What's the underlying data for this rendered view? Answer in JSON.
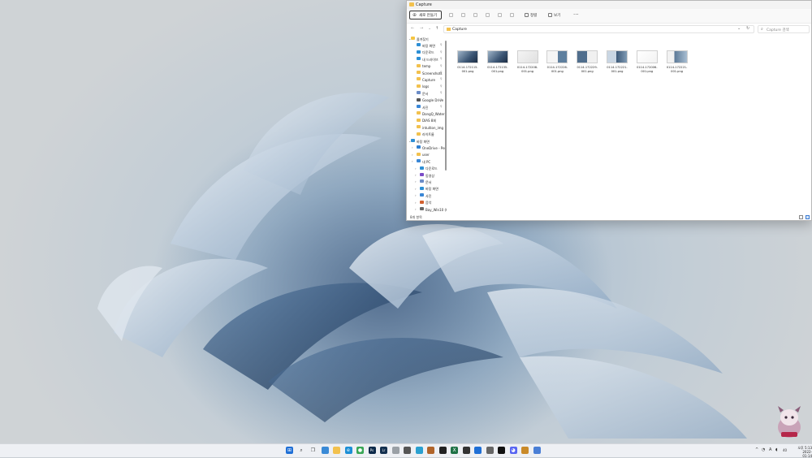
{
  "window": {
    "title": "Capture",
    "toolbar": {
      "new_label": "새로 만들기",
      "sort_label": "정렬",
      "view_label": "보기",
      "more_label": "···"
    },
    "address": {
      "path": "Capture",
      "breadcrumb_sep": "›"
    },
    "search": {
      "placeholder": "Capture 검색"
    },
    "nav": [
      {
        "label": "즐겨찾기",
        "color": "#f5c543",
        "pinned": false,
        "level": 0
      },
      {
        "label": "바탕 화면",
        "color": "#2d8fd5",
        "pinned": true,
        "level": 1
      },
      {
        "label": "다운로드",
        "color": "#2d8fd5",
        "pinned": true,
        "level": 1
      },
      {
        "label": "내 드라이브",
        "color": "#2d8fd5",
        "pinned": true,
        "level": 1
      },
      {
        "label": "temp",
        "color": "#f2c14e",
        "pinned": true,
        "level": 1
      },
      {
        "label": "Screenshots",
        "color": "#f2c14e",
        "pinned": true,
        "level": 1
      },
      {
        "label": "Capture",
        "color": "#f2c14e",
        "pinned": true,
        "level": 1
      },
      {
        "label": "logs",
        "color": "#f2c14e",
        "pinned": true,
        "level": 1
      },
      {
        "label": "문서",
        "color": "#6b8cc7",
        "pinned": true,
        "level": 1
      },
      {
        "label": "Google Drive",
        "color": "#555555",
        "pinned": true,
        "level": 1
      },
      {
        "label": "사진",
        "color": "#3a87d6",
        "pinned": true,
        "level": 1
      },
      {
        "label": "DongQ_Water",
        "color": "#f2c14e",
        "pinned": false,
        "level": 1
      },
      {
        "label": "DIAS 8회",
        "color": "#f2c14e",
        "pinned": false,
        "level": 1
      },
      {
        "label": "intuition_img",
        "color": "#f2c14e",
        "pinned": false,
        "level": 1
      },
      {
        "label": "라이트룸",
        "color": "#f2c14e",
        "pinned": false,
        "level": 1
      },
      {
        "label": "바탕 화면",
        "color": "#2d8fd5",
        "pinned": false,
        "level": 0
      },
      {
        "label": "OneDrive - Pers",
        "color": "#2f7fd1",
        "pinned": false,
        "level": 1
      },
      {
        "label": "user",
        "color": "#f2c14e",
        "pinned": false,
        "level": 1
      },
      {
        "label": "내 PC",
        "color": "#3a87d6",
        "pinned": false,
        "level": 1
      },
      {
        "label": "다운로드",
        "color": "#2d8fd5",
        "pinned": false,
        "level": 2
      },
      {
        "label": "동영상",
        "color": "#7a4bc7",
        "pinned": false,
        "level": 2
      },
      {
        "label": "문서",
        "color": "#6b8cc7",
        "pinned": false,
        "level": 2
      },
      {
        "label": "바탕 화면",
        "color": "#2d8fd5",
        "pinned": false,
        "level": 2
      },
      {
        "label": "사진",
        "color": "#3a87d6",
        "pinned": false,
        "level": 2
      },
      {
        "label": "음악",
        "color": "#d2602f",
        "pinned": false,
        "level": 2
      },
      {
        "label": "Bay_Win10 (C:",
        "color": "#666666",
        "pinned": false,
        "level": 2
      }
    ],
    "files": [
      {
        "name": "0114-172115-001.png",
        "thumb": "dark"
      },
      {
        "name": "0114-172135-001.png",
        "thumb": "dark"
      },
      {
        "name": "0114-172208-001.png",
        "thumb": "light"
      },
      {
        "name": "0114-172226-001.png",
        "thumb": "light-dark"
      },
      {
        "name": "0114-172229-001.png",
        "thumb": "dark-light"
      },
      {
        "name": "0114-172221-001.png",
        "thumb": "mixed"
      },
      {
        "name": "0114-172006-001.png",
        "thumb": "white"
      },
      {
        "name": "0114-172221-001.png",
        "thumb": "mixed2"
      }
    ],
    "status": "8개 항목"
  },
  "taskbar": {
    "apps": [
      {
        "name": "start",
        "color": "#1f6fd6"
      },
      {
        "name": "search",
        "color": "#333333"
      },
      {
        "name": "task-view",
        "color": "#444444"
      },
      {
        "name": "widgets",
        "color": "#3a8ad6"
      },
      {
        "name": "file-explorer",
        "color": "#f2c14e"
      },
      {
        "name": "edge",
        "color": "#1c8fd6"
      },
      {
        "name": "chrome",
        "color": "#3aa757"
      },
      {
        "name": "photoshop",
        "color": "#0d2a4a"
      },
      {
        "name": "lightroom",
        "color": "#14304f"
      },
      {
        "name": "app-gray",
        "color": "#9aa0a6"
      },
      {
        "name": "app-calc",
        "color": "#555555"
      },
      {
        "name": "app-ccleaner",
        "color": "#2aa0d0"
      },
      {
        "name": "app-gem",
        "color": "#b0642a"
      },
      {
        "name": "app-term",
        "color": "#222222"
      },
      {
        "name": "excel",
        "color": "#1e7145"
      },
      {
        "name": "app-dark",
        "color": "#333333"
      },
      {
        "name": "app-blue",
        "color": "#1f6fd6"
      },
      {
        "name": "app-printer",
        "color": "#666666"
      },
      {
        "name": "app-black",
        "color": "#111111"
      },
      {
        "name": "discord",
        "color": "#5865f2"
      },
      {
        "name": "app-orange",
        "color": "#c98a2a"
      },
      {
        "name": "app-note",
        "color": "#4a7fd6"
      }
    ],
    "tray": {
      "chevron": "^",
      "lang": "A",
      "vol": "40"
    },
    "clock": {
      "time": "오후 5:13",
      "date": "2022-01-14"
    }
  }
}
